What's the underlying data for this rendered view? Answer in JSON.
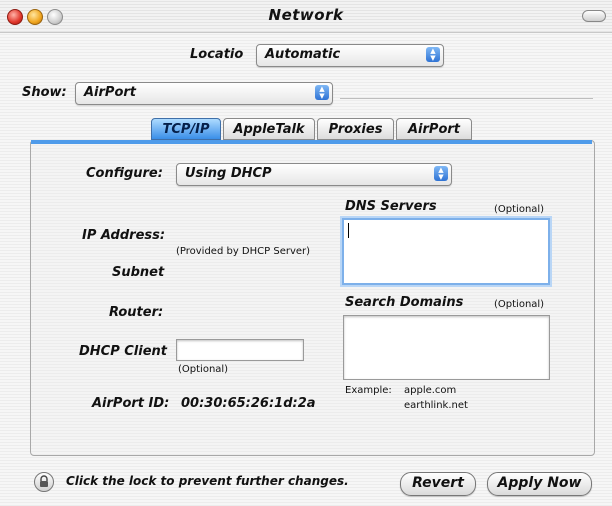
{
  "window": {
    "title": "Network"
  },
  "location": {
    "label": "Locatio",
    "value": "Automatic"
  },
  "show": {
    "label": "Show:",
    "value": "AirPort"
  },
  "tabs": [
    {
      "label": "TCP/IP",
      "active": true
    },
    {
      "label": "AppleTalk",
      "active": false
    },
    {
      "label": "Proxies",
      "active": false
    },
    {
      "label": "AirPort",
      "active": false
    }
  ],
  "tcpip": {
    "configure_label": "Configure:",
    "configure_value": "Using DHCP",
    "ip_label": "IP Address:",
    "provided_note": "(Provided by DHCP Server)",
    "subnet_label": "Subnet",
    "router_label": "Router:",
    "dhcp_client_label": "DHCP Client",
    "dhcp_client_value": "",
    "dhcp_optional": "(Optional)",
    "airport_id_label": "AirPort ID:",
    "airport_id_value": "00:30:65:26:1d:2a",
    "dns_label": "DNS Servers",
    "dns_optional": "(Optional)",
    "dns_value": "",
    "search_label": "Search Domains",
    "search_optional": "(Optional)",
    "search_value": "",
    "example_label": "Example:",
    "example_1": "apple.com",
    "example_2": "earthlink.net"
  },
  "footer": {
    "lock_text": "Click the lock to prevent further changes.",
    "revert_label": "Revert",
    "apply_label": "Apply Now"
  },
  "colors": {
    "accent": "#4f9bea",
    "tab_active": "#3a8ee8",
    "popup_arrow": "#2f73d4"
  }
}
